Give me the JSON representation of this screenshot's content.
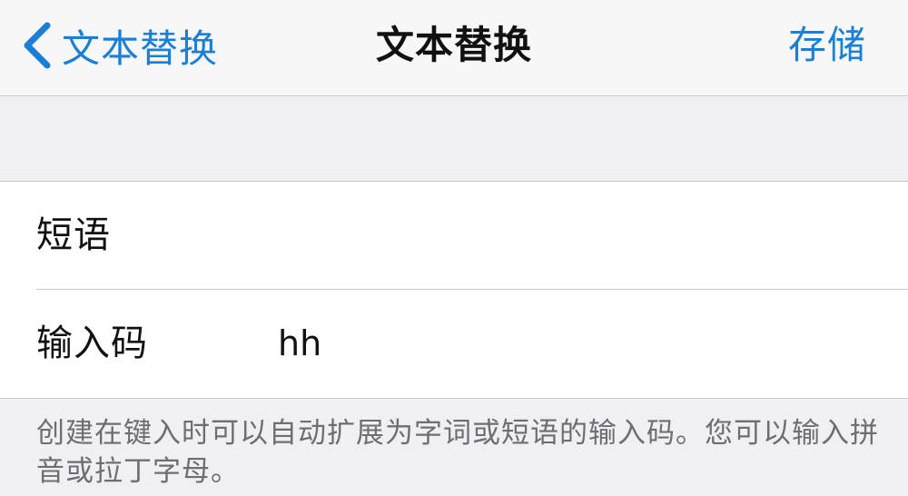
{
  "navbar": {
    "back_label": "文本替换",
    "title": "文本替换",
    "save_label": "存储"
  },
  "form": {
    "phrase": {
      "label": "短语",
      "value": ""
    },
    "shortcut": {
      "label": "输入码",
      "value": "hh"
    }
  },
  "footer": {
    "note": "创建在键入时可以自动扩展为字词或短语的输入码。您可以输入拼音或拉丁字母。"
  },
  "colors": {
    "accent": "#1a7fd6",
    "background": "#efeff4",
    "cell": "#ffffff",
    "separator": "#c8c7cc",
    "footnote": "#6d6d72"
  }
}
